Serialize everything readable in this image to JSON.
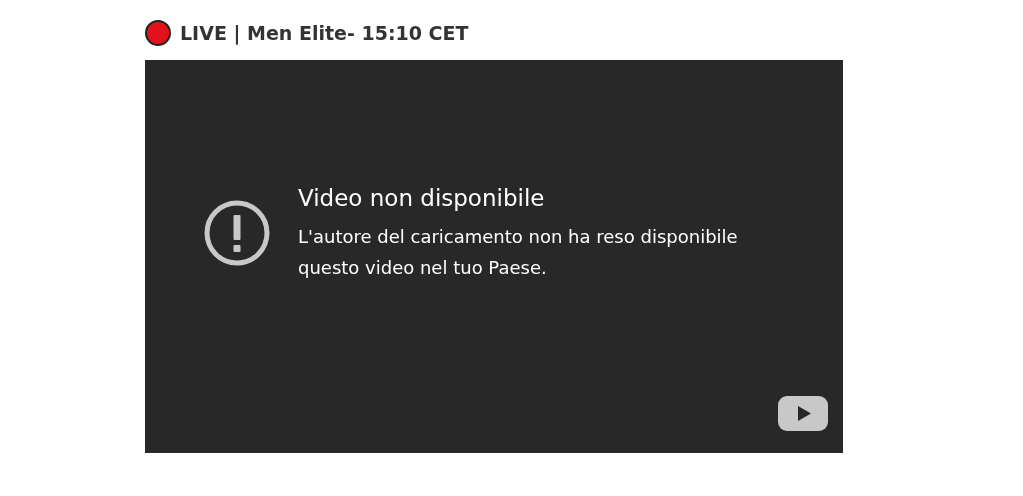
{
  "heading": {
    "live_dot": true,
    "text": "LIVE | Men Elite- 15:10 CET"
  },
  "player": {
    "error_title": "Video non disponibile",
    "error_message": "L'autore del caricamento non ha reso disponibile questo video nel tuo Paese."
  }
}
